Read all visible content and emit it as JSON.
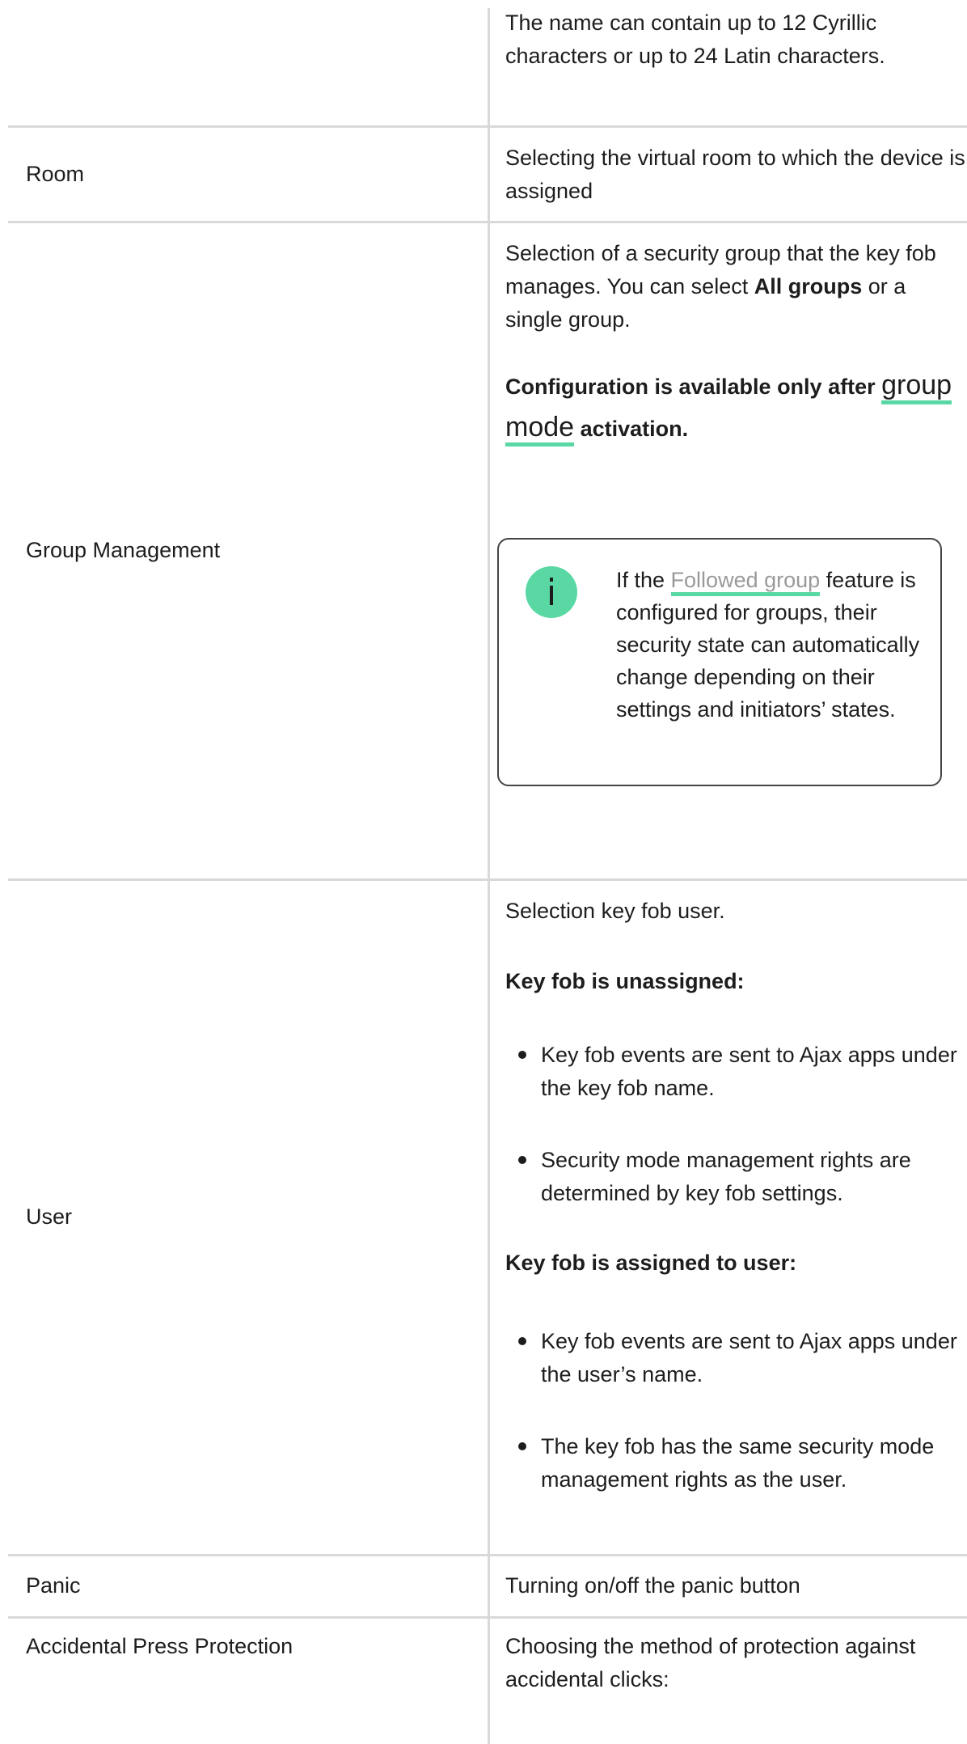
{
  "rows": {
    "name": {
      "desc": "The name can contain up to 12 Cyrillic characters or up to 24 Latin characters."
    },
    "room": {
      "label": "Room",
      "desc": "Selecting the virtual room to which the device is assigned"
    },
    "group": {
      "label": "Group Management",
      "desc_start": "Selection of a security group that the key fob manages. You can select ",
      "desc_bold": "All groups",
      "desc_end": " or a single group.",
      "note_start": "Configuration is available only after ",
      "note_link": "group mode",
      "note_end": " activation.",
      "info_start": "If the ",
      "info_link": "Followed group",
      "info_end": " feature is configured for groups, their security state can automatically change depending on their settings and initiators’ states."
    },
    "user": {
      "label": "User",
      "intro": "Selection key fob user.",
      "unassigned_heading": "Key fob is unassigned:",
      "unassigned_items": [
        "Key fob events are sent to Ajax apps under the key fob name.",
        "Security mode management rights are determined by key fob settings."
      ],
      "assigned_heading": "Key fob is assigned to user:",
      "assigned_items": [
        "Key fob events are sent to Ajax apps under the user’s name.",
        "The key fob has the same security mode management rights as the user."
      ]
    },
    "panic": {
      "label": "Panic",
      "desc": "Turning on/off the panic button"
    },
    "accidental": {
      "label": "Accidental Press Protection",
      "desc": "Choosing the method of protection against accidental clicks:"
    }
  },
  "colors": {
    "accent": "#5ad8a4",
    "border": "#d9d9d9",
    "text": "#1d1d1d",
    "muted_link": "#9a9a9a"
  },
  "icons": {
    "info": "info-icon"
  }
}
